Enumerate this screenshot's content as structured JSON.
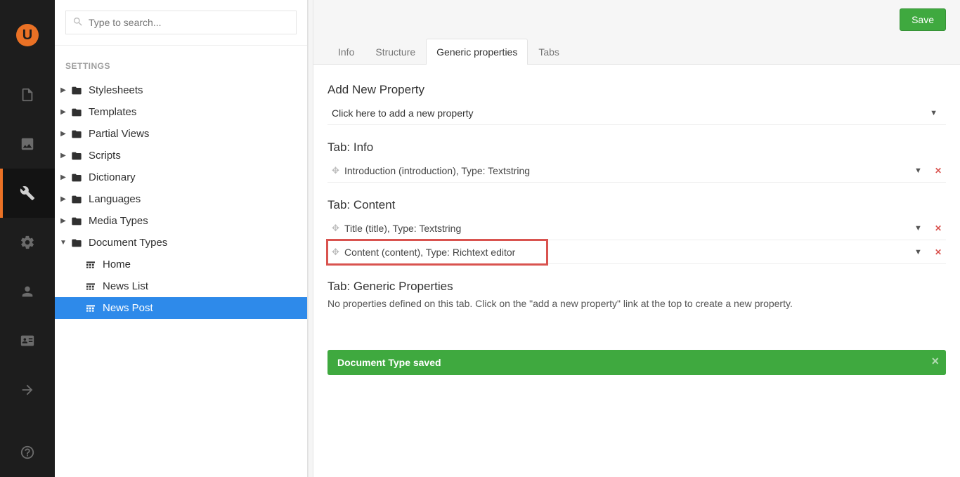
{
  "search": {
    "placeholder": "Type to search..."
  },
  "tree": {
    "section_label": "SETTINGS",
    "items": [
      {
        "label": "Stylesheets"
      },
      {
        "label": "Templates"
      },
      {
        "label": "Partial Views"
      },
      {
        "label": "Scripts"
      },
      {
        "label": "Dictionary"
      },
      {
        "label": "Languages"
      },
      {
        "label": "Media Types"
      },
      {
        "label": "Document Types"
      }
    ],
    "children": [
      {
        "label": "Home"
      },
      {
        "label": "News List"
      },
      {
        "label": "News Post"
      }
    ]
  },
  "toolbar": {
    "save_label": "Save"
  },
  "tabs": [
    {
      "label": "Info"
    },
    {
      "label": "Structure"
    },
    {
      "label": "Generic properties"
    },
    {
      "label": "Tabs"
    }
  ],
  "sections": {
    "addnew": {
      "title": "Add New Property",
      "row": "Click here to add a new property"
    },
    "info": {
      "title": "Tab: Info",
      "rows": [
        "Introduction (introduction), Type: Textstring"
      ]
    },
    "content": {
      "title": "Tab: Content",
      "rows": [
        "Title (title), Type: Textstring",
        "Content (content), Type: Richtext editor"
      ]
    },
    "generic": {
      "title": "Tab: Generic Properties",
      "help": "No properties defined on this tab. Click on the \"add a new property\" link at the top to create a new property."
    }
  },
  "toast": {
    "message": "Document Type saved"
  }
}
